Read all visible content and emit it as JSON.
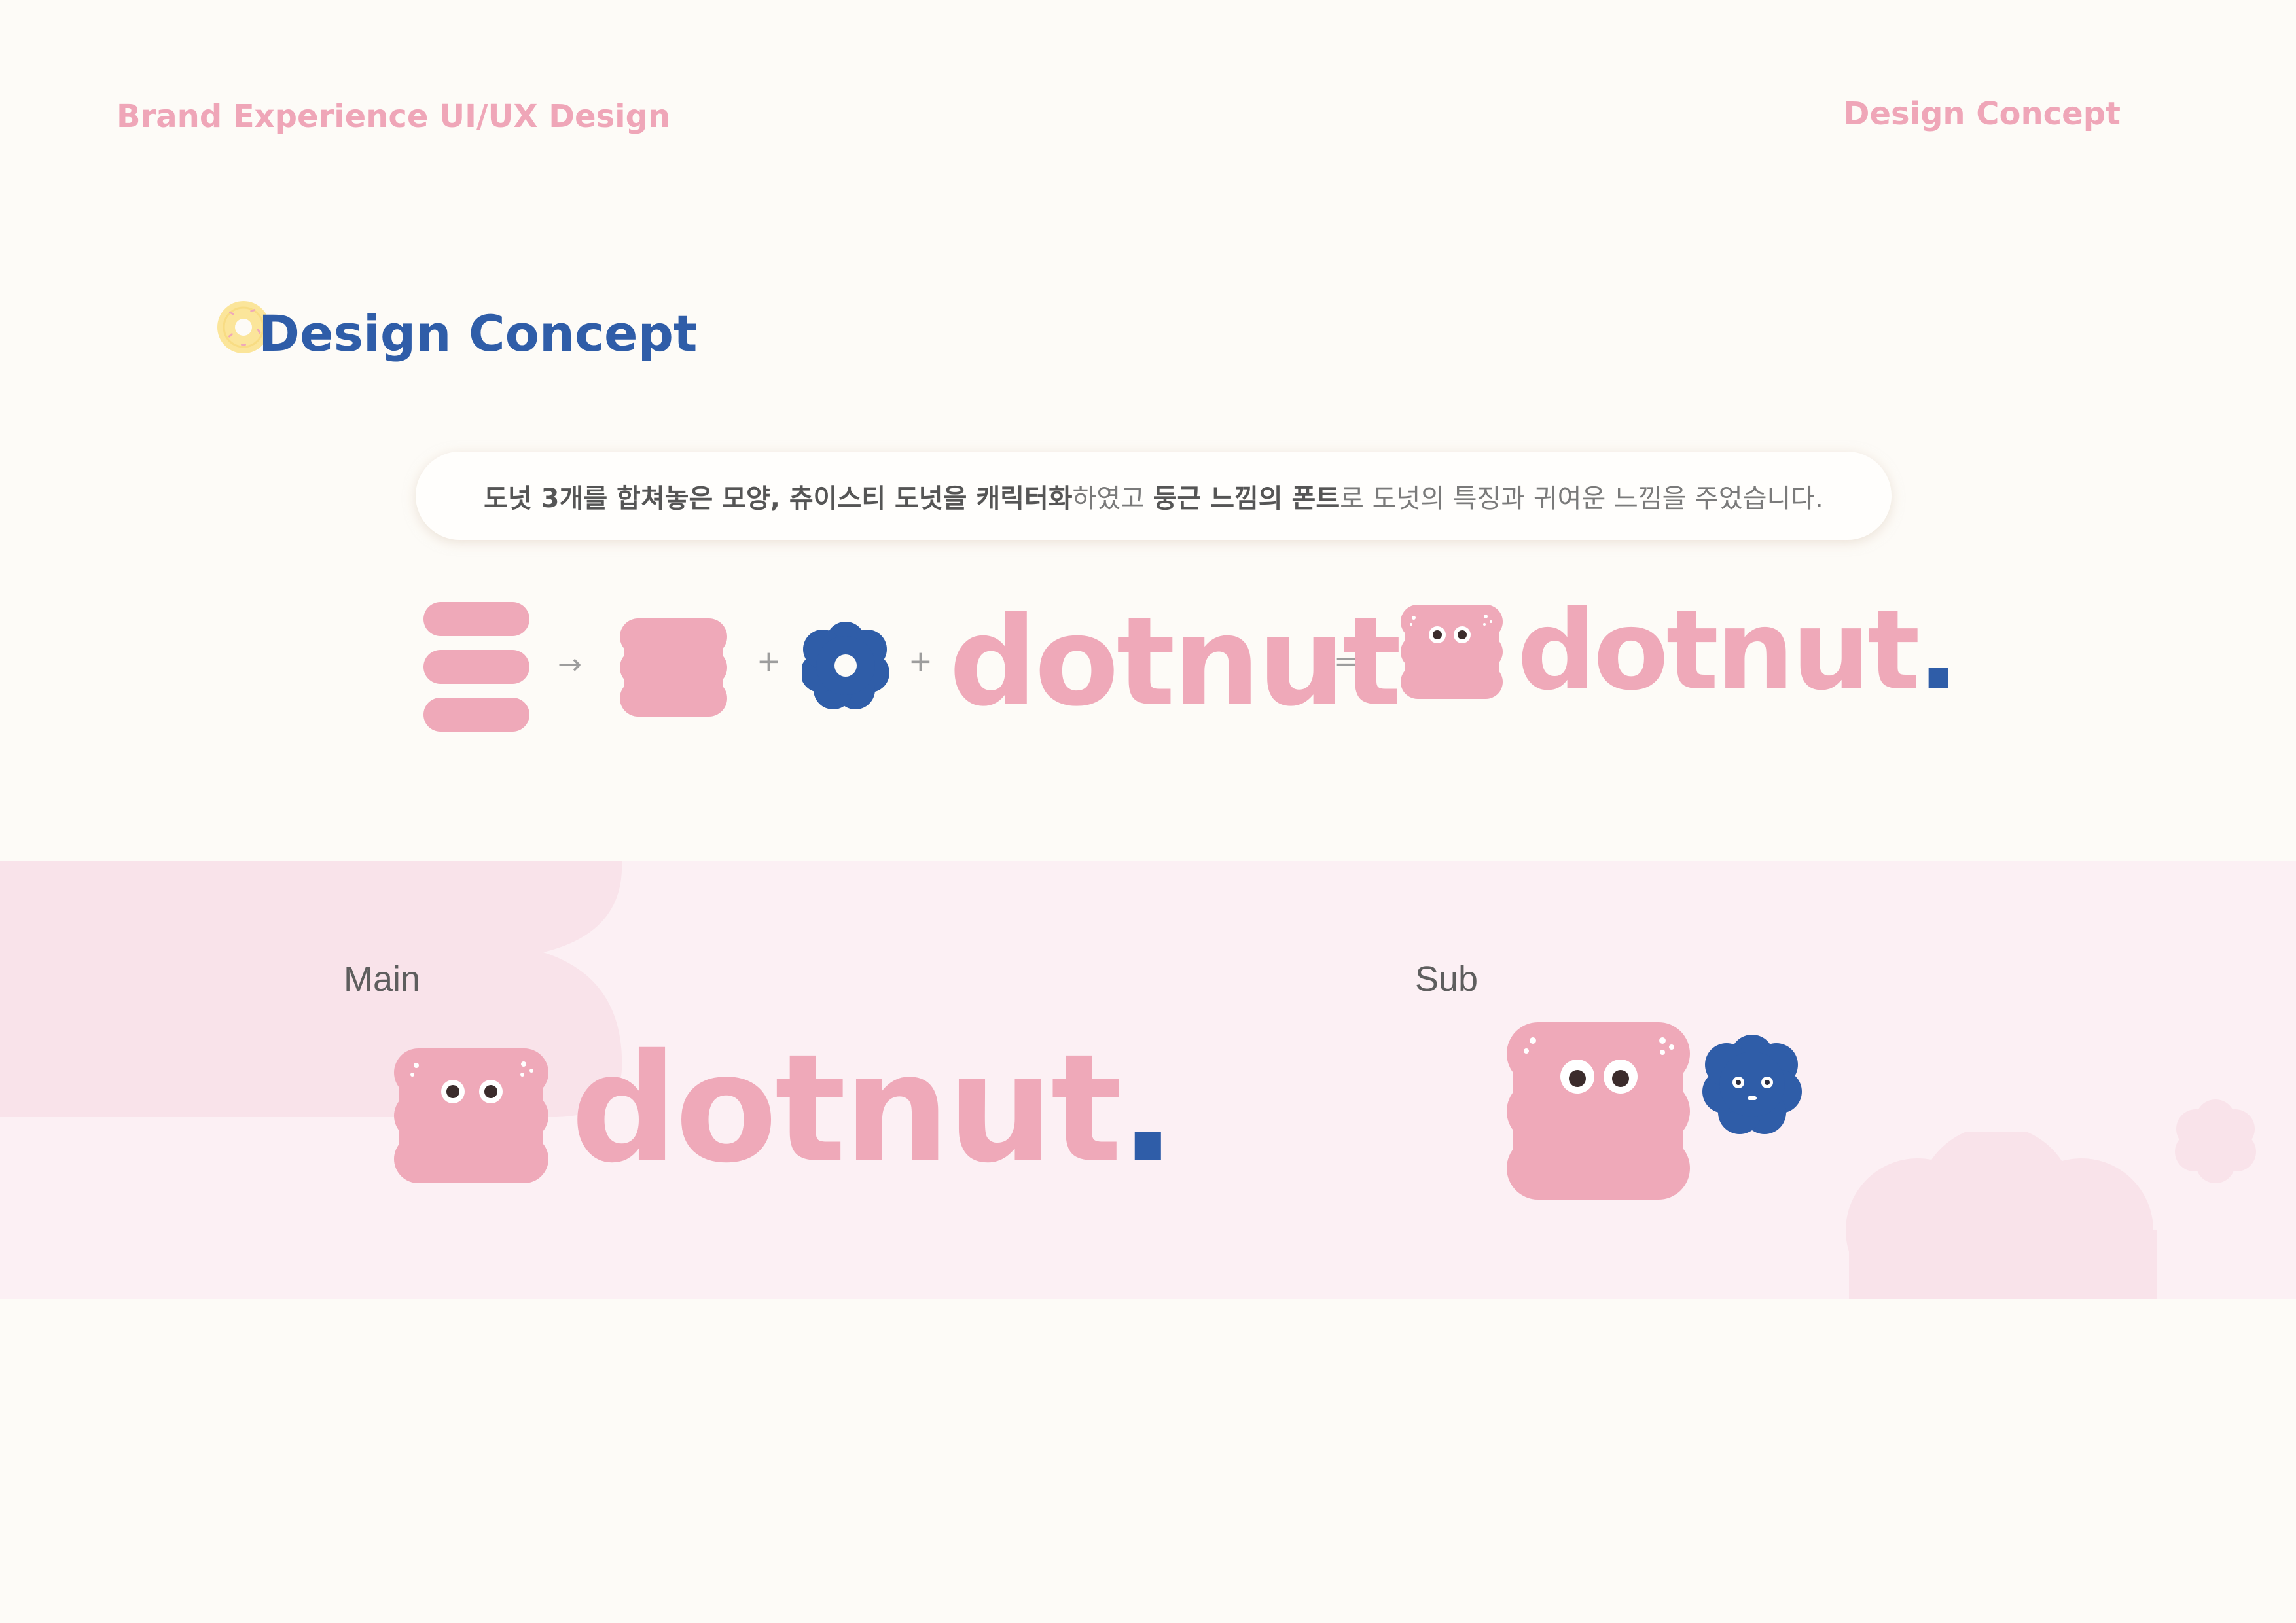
{
  "header": {
    "left_label": "Brand Experience UI/UX Design",
    "right_label": "Design Concept"
  },
  "section": {
    "title": "Design Concept",
    "title_icon": "donut-icon"
  },
  "description": {
    "part1_bold": "도넛 3개를 합쳐놓은 모양, 츄이스티 도넛을 캐릭터화",
    "part2": "하였고 ",
    "part3_bold": "둥근 느낌의 폰트",
    "part4": "로 도넛의 특징과 귀여운 느낌을 주었습니다."
  },
  "formula": {
    "arrow": "→",
    "plus1": "+",
    "plus2": "+",
    "equals": "=",
    "wordmark_plain": "dotnut",
    "wordmark_final": "dotnut",
    "final_dot": "."
  },
  "logos": {
    "main_label": "Main",
    "main_wordmark": "dotnut",
    "main_dot": ".",
    "sub_label": "Sub"
  },
  "colors": {
    "pink": "#efa9b9",
    "blue": "#2f5da8",
    "background": "#fdfbf7",
    "band": "#fcf0f4",
    "header_pink": "#efa6b8"
  }
}
